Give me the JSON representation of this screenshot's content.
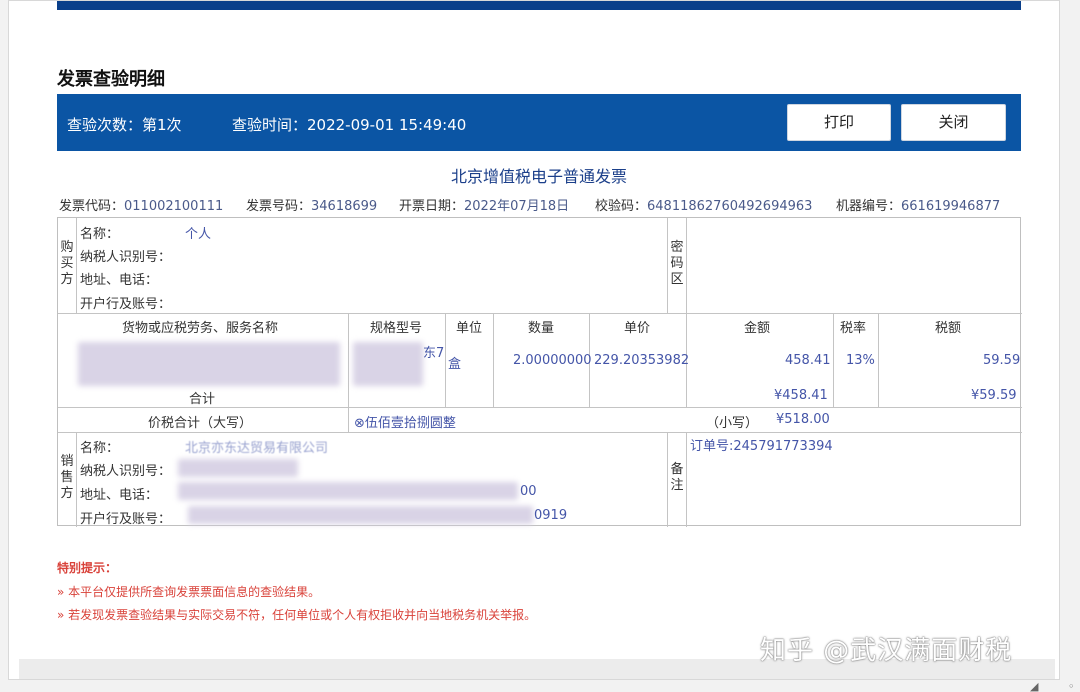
{
  "dialog": {
    "title": "发票查验明细",
    "check_count": "查验次数：第1次",
    "check_time": "查验时间：2022-09-01 15:49:40",
    "print_label": "打印",
    "close_label": "关闭"
  },
  "invoice": {
    "title": "北京增值税电子普通发票",
    "meta": {
      "code_label": "发票代码：",
      "code": "011002100111",
      "number_label": "发票号码：",
      "number": "34618699",
      "date_label": "开票日期：",
      "date": "2022年07月18日",
      "check_label": "校验码：",
      "check": "64811862760492694963",
      "machine_label": "机器编号：",
      "machine": "661619946877"
    },
    "buyer": {
      "side_label": "购买方",
      "name_label": "名称：",
      "name": "个人",
      "tax_label": "纳税人识别号：",
      "addr_label": "地址、电话：",
      "bank_label": "开户行及账号："
    },
    "password_label": "密码区",
    "items_header": {
      "goods": "货物或应税劳务、服务名称",
      "spec": "规格型号",
      "unit": "单位",
      "qty": "数量",
      "price": "单价",
      "amount": "金额",
      "rate": "税率",
      "tax": "税额"
    },
    "item": {
      "spec_partial": "东7",
      "unit": "盒",
      "qty": "2.00000000",
      "price": "229.20353982",
      "amount": "458.41",
      "rate": "13%",
      "tax": "59.59"
    },
    "total": {
      "label": "合计",
      "amount": "¥458.41",
      "tax": "¥59.59"
    },
    "grand_total": {
      "label": "价税合计（大写）",
      "upper": "⊗伍佰壹拾捌圆整",
      "lower_label": "（小写）",
      "lower": "¥518.00"
    },
    "seller": {
      "side_label": "销售方",
      "name_label": "名称：",
      "name_partial": "北京亦东达贸易有限公司",
      "tax_label": "纳税人识别号：",
      "addr_label": "地址、电话：",
      "addr_tail": "00",
      "bank_label": "开户行及账号：",
      "bank_tail": "0919"
    },
    "remark_label": "备注",
    "remark": "订单号:245791773394"
  },
  "tips": {
    "heading": "特别提示：",
    "items": [
      "» 本平台仅提供所查询发票票面信息的查验结果。",
      "» 若发现发票查验结果与实际交易不符，任何单位或个人有权拒收并向当地税务机关举报。"
    ]
  },
  "brand": "知乎 @武汉满面财税",
  "colors": {
    "header_blue": "#0b55a4",
    "tip_red": "#d9423a",
    "value_blue": "#4455a8"
  }
}
